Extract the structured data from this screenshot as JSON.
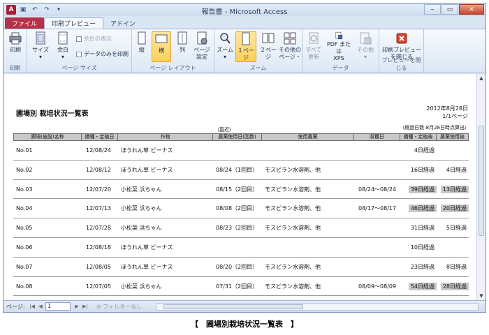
{
  "window": {
    "title": "報告書 - Microsoft Access",
    "controls": [
      "‒",
      "▭",
      "✕"
    ]
  },
  "tabs": [
    {
      "label": "ファイル",
      "kind": "file"
    },
    {
      "label": "印刷プレビュー",
      "kind": "active"
    },
    {
      "label": "アドイン",
      "kind": "normal"
    }
  ],
  "ribbon": {
    "groups": {
      "print": "印刷",
      "page_size": "ページ サイズ",
      "page_layout": "ページ レイアウト",
      "zoom": "ズーム",
      "data": "データ",
      "close": "プレビューを閉じる"
    },
    "buttons": {
      "print": "印刷",
      "size": "サイズ",
      "margin": "余白",
      "show_margins": "余白の表示",
      "data_only": "データのみを印刷",
      "portrait": "縦",
      "landscape": "横",
      "columns": "列",
      "page_setup_1": "ページ",
      "page_setup_2": "設定",
      "zoom": "ズーム",
      "one_page": "１ページ",
      "two_pages": "２ページ",
      "more_pages_1": "その他の",
      "more_pages_2": "ページ・",
      "refresh_all_1": "すべて",
      "refresh_all_2": "更新",
      "pdf_xps_1": "PDF または",
      "pdf_xps_2": "XPS",
      "other": "その他",
      "close_preview_1": "印刷プレビュー",
      "close_preview_2": "を閉じる"
    }
  },
  "report": {
    "title": "圃場別 栽培状況一覧表",
    "date": "2012年8月28日",
    "page": "1/1ページ",
    "note_recent": "（直近）",
    "note_elapsed": "（経過日数:8月28日時点算出）",
    "headers": [
      "圃場(施設)名称",
      "播種・定植日",
      "作物",
      "農薬使用日(回数)",
      "使用農薬",
      "収穫日",
      "播種・定植後",
      "農薬使用後"
    ],
    "rows": [
      {
        "field": "No.01",
        "date": "12/08/24",
        "crop": "ほうれん草 ビーナス",
        "pest_date": "",
        "pest": "",
        "harvest": "",
        "sow_elapsed": "4日経過",
        "sow_gray": false,
        "pest_elapsed": "",
        "pest_gray": false
      },
      {
        "field": "No.02",
        "date": "12/08/12",
        "crop": "ほうれん草 ビーナス",
        "pest_date": "08/24（1回目）",
        "pest": "モスピラン水溶剤、他",
        "harvest": "",
        "sow_elapsed": "16日経過",
        "sow_gray": false,
        "pest_elapsed": "4日経過",
        "pest_gray": false
      },
      {
        "field": "No.03",
        "date": "12/07/20",
        "crop": "小松菜 浜ちゃん",
        "pest_date": "08/15（2回目）",
        "pest": "モスピラン水溶剤、他",
        "harvest": "08/24〜08/24",
        "sow_elapsed": "39日経過",
        "sow_gray": true,
        "pest_elapsed": "13日経過",
        "pest_gray": true
      },
      {
        "field": "No.04",
        "date": "12/07/13",
        "crop": "小松菜 浜ちゃん",
        "pest_date": "08/08（2回目）",
        "pest": "モスピラン水溶剤、他",
        "harvest": "08/17〜08/17",
        "sow_elapsed": "46日経過",
        "sow_gray": true,
        "pest_elapsed": "20日経過",
        "pest_gray": true
      },
      {
        "field": "No.05",
        "date": "12/07/28",
        "crop": "小松菜 浜ちゃん",
        "pest_date": "08/23（2回目）",
        "pest": "モスピラン水溶剤、他",
        "harvest": "",
        "sow_elapsed": "31日経過",
        "sow_gray": false,
        "pest_elapsed": "5日経過",
        "pest_gray": false
      },
      {
        "field": "No.06",
        "date": "12/08/18",
        "crop": "ほうれん草 ビーナス",
        "pest_date": "",
        "pest": "",
        "harvest": "",
        "sow_elapsed": "10日経過",
        "sow_gray": false,
        "pest_elapsed": "",
        "pest_gray": false
      },
      {
        "field": "No.07",
        "date": "12/08/05",
        "crop": "ほうれん草 ビーナス",
        "pest_date": "08/20（2回目）",
        "pest": "モスピラン水溶剤、他",
        "harvest": "",
        "sow_elapsed": "23日経過",
        "sow_gray": false,
        "pest_elapsed": "8日経過",
        "pest_gray": false
      },
      {
        "field": "No.08",
        "date": "12/07/05",
        "crop": "小松菜 浜ちゃん",
        "pest_date": "07/31（2回目）",
        "pest": "モスピラン水溶剤、他",
        "harvest": "08/09〜08/09",
        "sow_elapsed": "54日経過",
        "sow_gray": true,
        "pest_elapsed": "28日経過",
        "pest_gray": true
      }
    ]
  },
  "statusbar": {
    "page_label": "ページ:",
    "page_value": "1",
    "filter": "フィルターなし"
  },
  "caption": "【　圃場別栽培状況一覧表　】",
  "colors": {
    "file_tab": "#b7314a",
    "selected_button": "#ffcf5a",
    "close_red": "#c8442c"
  }
}
